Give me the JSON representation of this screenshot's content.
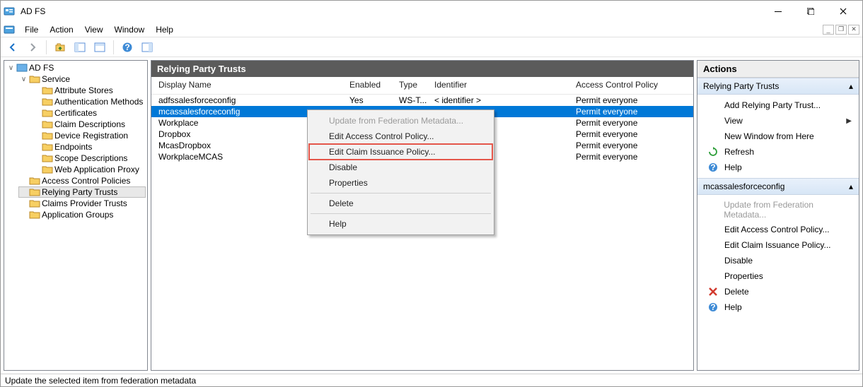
{
  "window": {
    "title": "AD FS"
  },
  "menus": {
    "file": "File",
    "action": "Action",
    "view": "View",
    "window": "Window",
    "help": "Help"
  },
  "tree": {
    "root": "AD FS",
    "service": "Service",
    "service_children": [
      "Attribute Stores",
      "Authentication Methods",
      "Certificates",
      "Claim Descriptions",
      "Device Registration",
      "Endpoints",
      "Scope Descriptions",
      "Web Application Proxy"
    ],
    "acp": "Access Control Policies",
    "rpt": "Relying Party Trusts",
    "cpt": "Claims Provider Trusts",
    "appg": "Application Groups"
  },
  "center": {
    "title": "Relying Party Trusts",
    "cols": {
      "name": "Display Name",
      "enabled": "Enabled",
      "type": "Type",
      "identifier": "Identifier",
      "acp": "Access Control Policy"
    },
    "rows": [
      {
        "name": "adfssalesforceconfig",
        "enabled": "Yes",
        "type": "WS-T...",
        "identifier": "< identifier >",
        "acp": "Permit everyone"
      },
      {
        "name": "mcassalesforceconfig",
        "enabled": "",
        "type": "",
        "identifier": "",
        "acp": "Permit everyone"
      },
      {
        "name": "Workplace",
        "enabled": "",
        "type": "",
        "identifier": "",
        "acp": "Permit everyone"
      },
      {
        "name": "Dropbox",
        "enabled": "",
        "type": "",
        "identifier": "",
        "acp": "Permit everyone"
      },
      {
        "name": "McasDropbox",
        "enabled": "",
        "type": "",
        "identifier": "",
        "acp": "Permit everyone"
      },
      {
        "name": "WorkplaceMCAS",
        "enabled": "",
        "type": "",
        "identifier": "",
        "acp": "Permit everyone"
      }
    ]
  },
  "contextmenu": {
    "update": "Update from Federation Metadata...",
    "editacp": "Edit Access Control Policy...",
    "editcip": "Edit Claim Issuance Policy...",
    "disable": "Disable",
    "properties": "Properties",
    "delete": "Delete",
    "help": "Help"
  },
  "actions": {
    "title": "Actions",
    "group1_title": "Relying Party Trusts",
    "group1": {
      "addrpt": "Add Relying Party Trust...",
      "view": "View",
      "newwin": "New Window from Here",
      "refresh": "Refresh",
      "help": "Help"
    },
    "group2_title": "mcassalesforceconfig",
    "group2": {
      "update": "Update from Federation Metadata...",
      "editacp": "Edit Access Control Policy...",
      "editcip": "Edit Claim Issuance Policy...",
      "disable": "Disable",
      "properties": "Properties",
      "delete": "Delete",
      "help": "Help"
    }
  },
  "statusbar": "Update the selected item from federation metadata"
}
